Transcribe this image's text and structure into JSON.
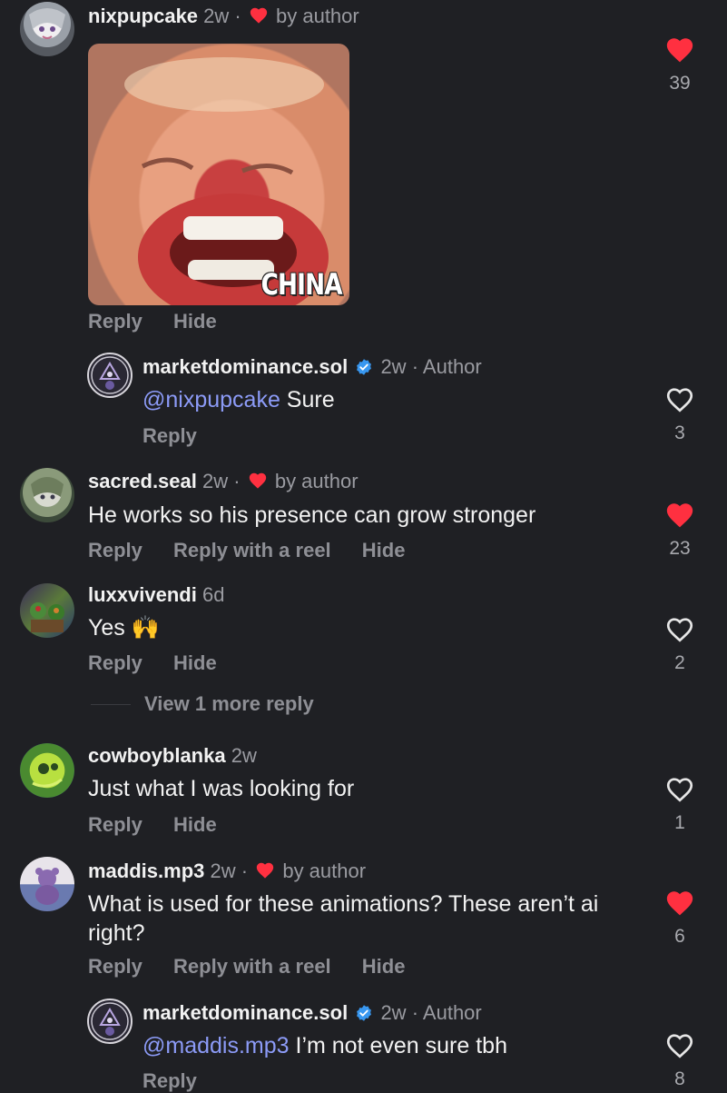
{
  "colors": {
    "background": "#1f2024",
    "heart_red": "#ff3040",
    "mention": "#8c9bf7",
    "verified": "#3897f0"
  },
  "comments": [
    {
      "username": "nixpupcake",
      "time": "2w",
      "by_author": "by author",
      "image_caption": "CHINA",
      "actions": [
        "Reply",
        "Hide"
      ],
      "likes": "39",
      "liked": true
    },
    {
      "username": "marketdominance.sol",
      "time": "2w",
      "author_tag": "Author",
      "mention": "@nixpupcake",
      "text": " Sure",
      "actions": [
        "Reply"
      ],
      "likes": "3",
      "liked": false
    },
    {
      "username": "sacred.seal",
      "time": "2w",
      "by_author": "by author",
      "text": "He works so his presence can grow stronger",
      "actions": [
        "Reply",
        "Reply with a reel",
        "Hide"
      ],
      "likes": "23",
      "liked": true
    },
    {
      "username": "luxxvivendi",
      "time": "6d",
      "text": "Yes 🙌",
      "actions": [
        "Reply",
        "Hide"
      ],
      "likes": "2",
      "liked": false,
      "view_more": "View 1 more reply"
    },
    {
      "username": "cowboyblanka",
      "time": "2w",
      "text": "Just what I was looking for",
      "actions": [
        "Reply",
        "Hide"
      ],
      "likes": "1",
      "liked": false
    },
    {
      "username": "maddis.mp3",
      "time": "2w",
      "by_author": "by author",
      "text": "What is used for these animations? These aren’t ai right?",
      "actions": [
        "Reply",
        "Reply with a reel",
        "Hide"
      ],
      "likes": "6",
      "liked": true
    },
    {
      "username": "marketdominance.sol",
      "time": "2w",
      "author_tag": "Author",
      "mention": "@maddis.mp3",
      "text": " I’m not even sure tbh",
      "actions": [
        "Reply"
      ],
      "likes": "8",
      "liked": false
    }
  ]
}
